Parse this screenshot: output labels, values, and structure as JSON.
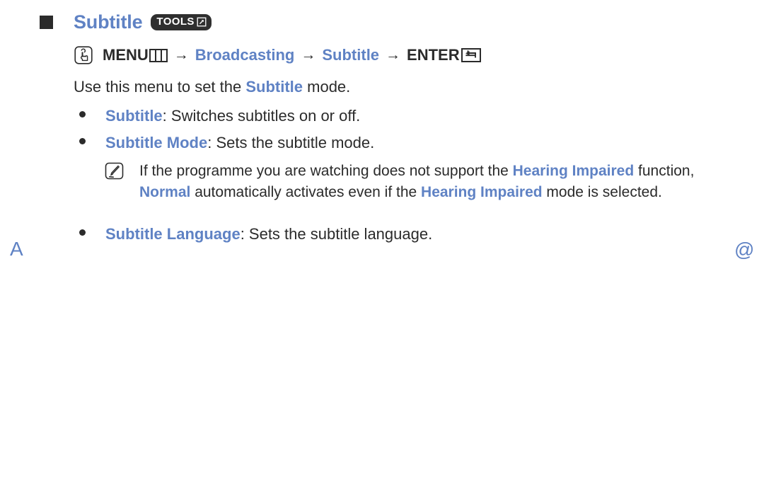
{
  "heading": {
    "square_icon": "filled-square-bullet",
    "title": "Subtitle",
    "badge": {
      "label": "TOOLS",
      "icon": "external-link-arrow-icon"
    }
  },
  "nav_path": {
    "remote_icon": "hand-press-button-icon",
    "menu_label": "MENU",
    "menu_icon": "menu-grid-icon",
    "arrow1": "→",
    "broadcasting_label": "Broadcasting",
    "arrow2": "→",
    "subtitle_label": "Subtitle",
    "arrow3": "→",
    "enter_label": "ENTER",
    "enter_icon": "return-key-icon"
  },
  "lead": {
    "part1": "Use this menu to set the ",
    "emphasis": "Subtitle",
    "part2": " mode."
  },
  "bullets": [
    {
      "term": "Subtitle",
      "description": ": Switches subtitles on or off."
    },
    {
      "term": "Subtitle Mode",
      "description": ": Sets the subtitle mode."
    },
    {
      "term": "Subtitle Language",
      "description": ": Sets the subtitle language."
    }
  ],
  "note": {
    "icon": "note-pencil-icon",
    "seg1": "If the programme you are watching does not support the ",
    "seg2": "Hearing Impaired",
    "seg3": " function, ",
    "seg4": "Normal",
    "seg5": " automatically activates even if the ",
    "seg6": "Hearing Impaired",
    "seg7": " mode is selected."
  },
  "margin_marks": {
    "left": "A",
    "right": "@"
  },
  "colors": {
    "accent_blue": "#5f82c4",
    "text_dark": "#2b2b2b",
    "badge_bg": "#2f2f2f",
    "page_bg": "#ffffff"
  }
}
